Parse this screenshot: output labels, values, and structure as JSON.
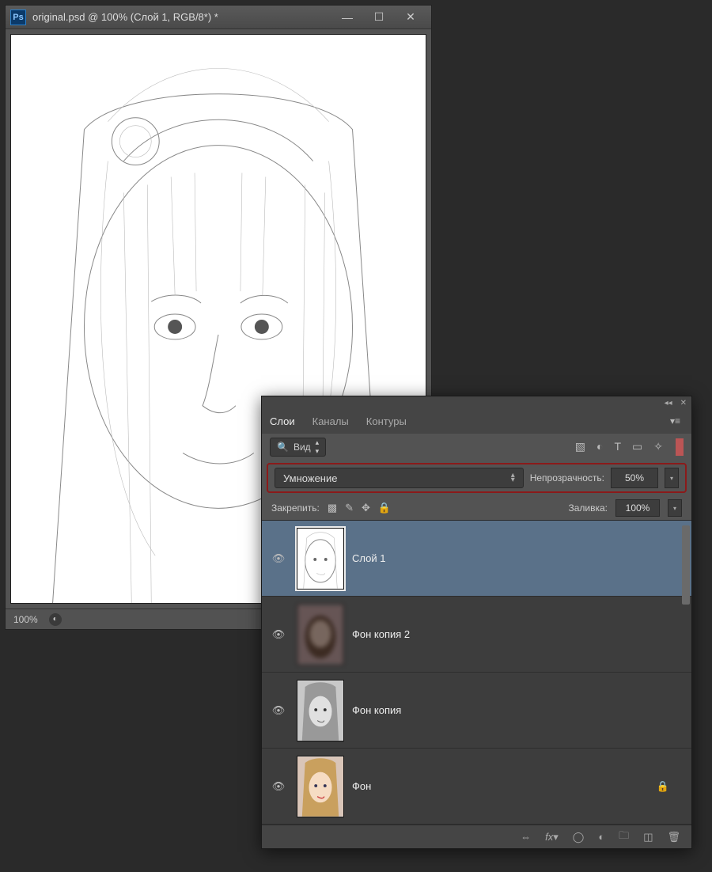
{
  "doc": {
    "title": "original.psd @ 100% (Слой 1, RGB/8*) *",
    "zoom": "100%"
  },
  "panel": {
    "tabs": {
      "layers": "Слои",
      "channels": "Каналы",
      "paths": "Контуры"
    },
    "search_label": "Вид",
    "blend_mode": "Умножение",
    "opacity_label": "Непрозрачность:",
    "opacity_value": "50%",
    "lock_label": "Закрепить:",
    "fill_label": "Заливка:",
    "fill_value": "100%",
    "layers": [
      {
        "name": "Слой 1",
        "selected": true,
        "locked": false,
        "thumb": "sketch"
      },
      {
        "name": "Фон копия 2",
        "selected": false,
        "locked": false,
        "thumb": "blur"
      },
      {
        "name": "Фон копия",
        "selected": false,
        "locked": false,
        "thumb": "gray"
      },
      {
        "name": "Фон",
        "selected": false,
        "locked": true,
        "thumb": "color"
      }
    ]
  }
}
